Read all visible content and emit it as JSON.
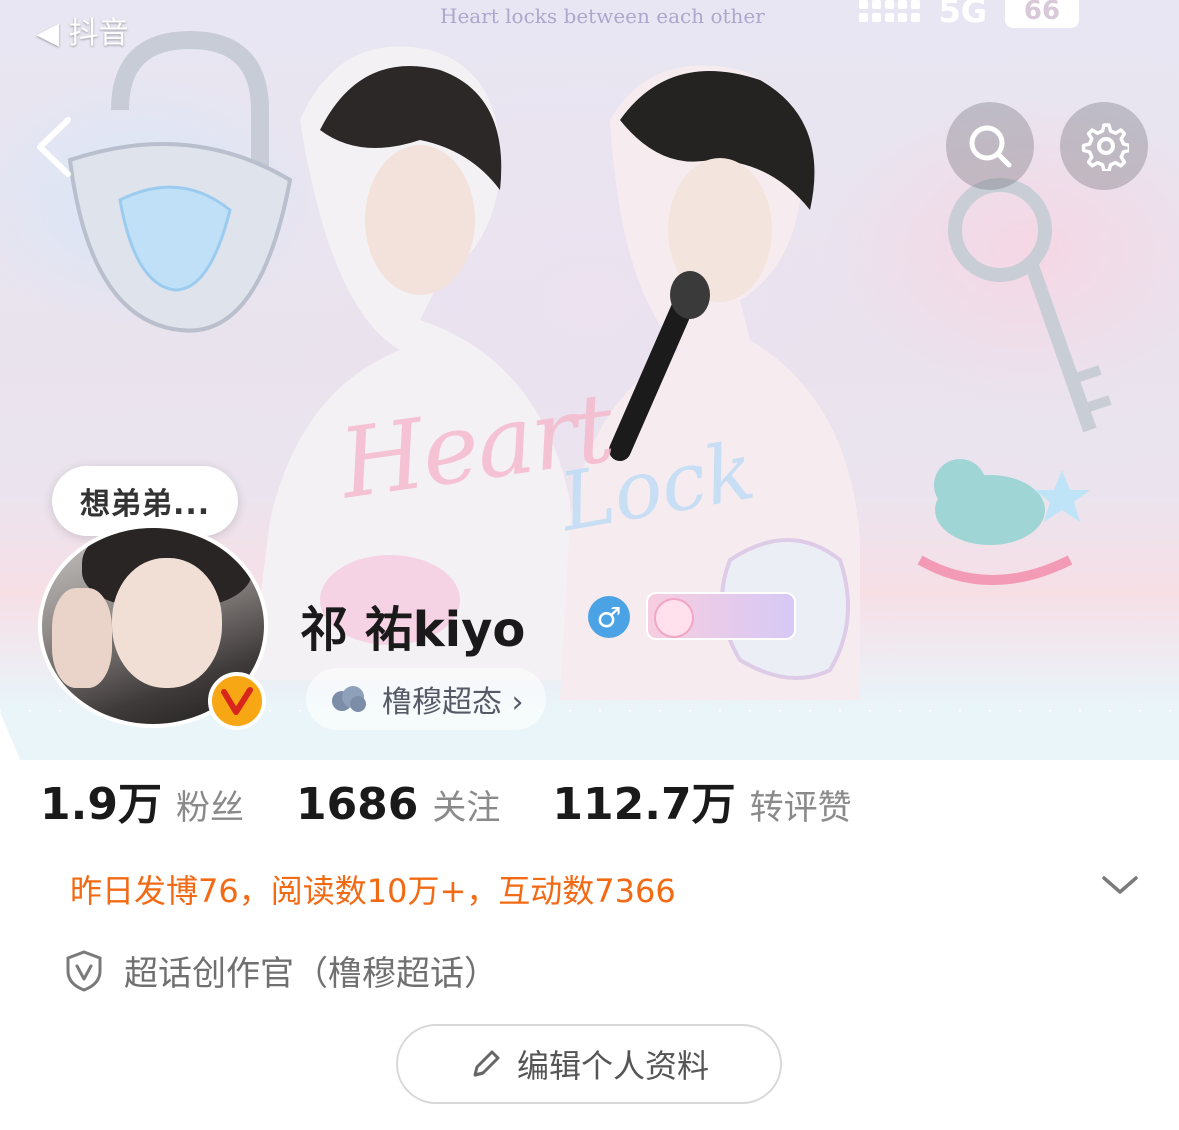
{
  "status_bar": {
    "source_app": "◀ 抖音",
    "network": "5G",
    "battery": "66"
  },
  "banner": {
    "caption": "Heart locks between each other",
    "watermark_line1": "Heart",
    "watermark_line2": "Lock"
  },
  "header": {
    "back_icon": "chevron-left-icon",
    "search_icon": "search-icon",
    "settings_icon": "gear-icon"
  },
  "profile": {
    "mood_status": "想弟弟...",
    "username": "祁 祐kiyo",
    "gender": "♂",
    "super_topic_label": "橹穆超态 ›",
    "verified_color": "#f7a713"
  },
  "stats": [
    {
      "value": "1.9万",
      "label": "粉丝"
    },
    {
      "value": "1686",
      "label": "关注"
    },
    {
      "value": "112.7万",
      "label": "转评赞"
    }
  ],
  "activity": {
    "yesterday_summary": "昨日发博76，阅读数10万+，互动数7366",
    "accent_color": "#f26a14"
  },
  "credential": {
    "text": "超话创作官（橹穆超话）"
  },
  "actions": {
    "edit_profile": "编辑个人资料"
  }
}
